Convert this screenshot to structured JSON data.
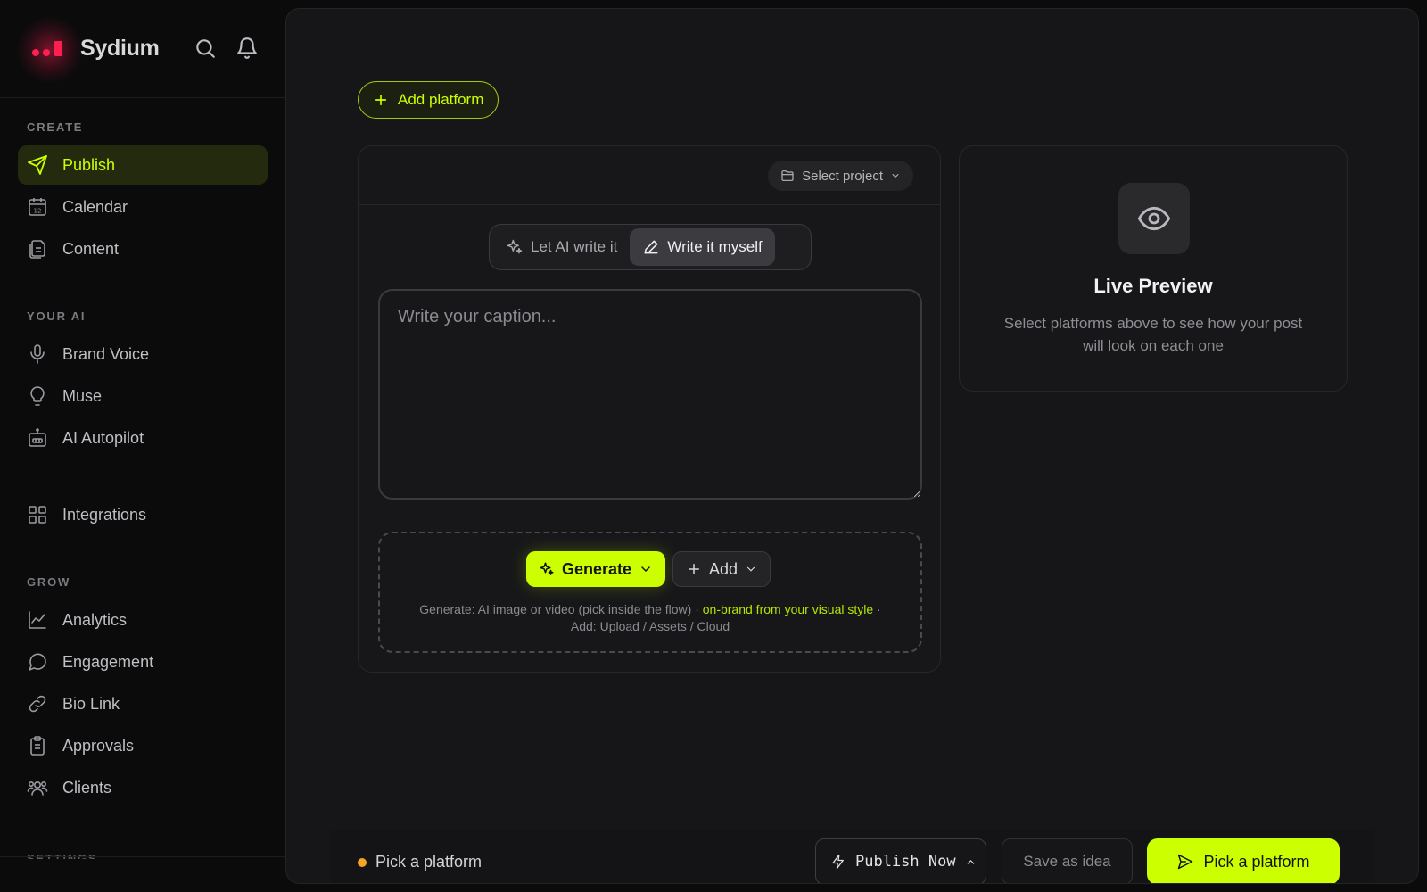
{
  "brand": {
    "name": "Sydium",
    "accent": "#ccff00",
    "logo_color": "#ff1e50"
  },
  "sidebar": {
    "sections": {
      "create": "CREATE",
      "your_ai": "YOUR AI",
      "grow": "GROW",
      "settings": "SETTINGS"
    },
    "items": {
      "publish": {
        "label": "Publish",
        "icon": "send-icon",
        "active": true
      },
      "calendar": {
        "label": "Calendar",
        "icon": "calendar-icon"
      },
      "content": {
        "label": "Content",
        "icon": "files-icon"
      },
      "brand_voice": {
        "label": "Brand Voice",
        "icon": "microphone-icon"
      },
      "muse": {
        "label": "Muse",
        "icon": "lightbulb-icon"
      },
      "ai_autopilot": {
        "label": "AI Autopilot",
        "icon": "robot-icon"
      },
      "integrations": {
        "label": "Integrations",
        "icon": "grid-icon"
      },
      "analytics": {
        "label": "Analytics",
        "icon": "chart-line-icon"
      },
      "engagement": {
        "label": "Engagement",
        "icon": "chat-bubble-icon"
      },
      "bio_link": {
        "label": "Bio Link",
        "icon": "link-icon"
      },
      "approvals": {
        "label": "Approvals",
        "icon": "clipboard-icon"
      },
      "clients": {
        "label": "Clients",
        "icon": "users-icon"
      }
    }
  },
  "main": {
    "add_platform_label": "Add platform",
    "editor": {
      "select_project_label": "Select project",
      "mode_ai_label": "Let AI write it",
      "mode_self_label": "Write it myself",
      "active_mode": "self",
      "caption_placeholder": "Write your caption...",
      "caption_value": "",
      "media": {
        "generate_label": "Generate",
        "add_label": "Add",
        "help_part1": "Generate: AI image or video (pick inside the flow) · ",
        "help_highlight": "on-brand from your visual style",
        "help_sep": " ·",
        "help_line2": "Add: Upload / Assets / Cloud"
      }
    },
    "preview": {
      "title": "Live Preview",
      "description": "Select platforms above to see how your post will look on each one"
    }
  },
  "bottom_bar": {
    "status_text": "Pick a platform",
    "status_color": "#f5a524",
    "publish_now_label": "Publish Now",
    "save_idea_label": "Save as idea",
    "pick_platform_label": "Pick a platform"
  }
}
